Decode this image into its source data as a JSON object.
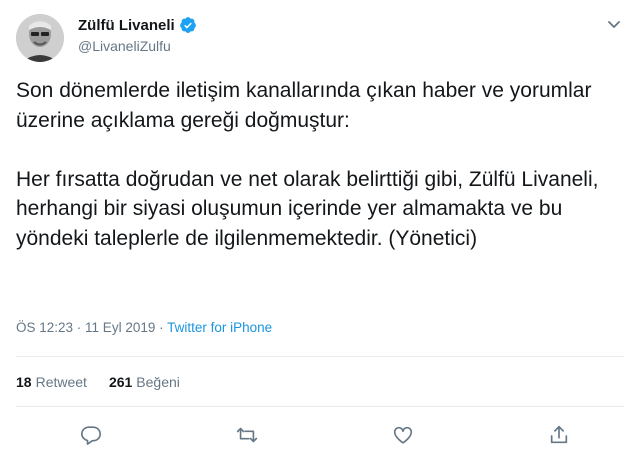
{
  "author": {
    "name": "Zülfü Livaneli",
    "handle": "@LivaneliZulfu"
  },
  "tweet": {
    "paragraph1": "Son dönemlerde iletişim kanallarında çıkan haber ve yorumlar üzerine açıklama gereği doğmuştur:",
    "paragraph2": "Her fırsatta doğrudan ve net olarak belirttiği gibi, Zülfü Livaneli, herhangi bir siyasi oluşumun içerinde yer almamakta ve  bu yöndeki taleplerle de ilgilenmemektedir. (Yönetici)"
  },
  "meta": {
    "time": "ÖS 12:23",
    "separator1": " · ",
    "date": "11 Eyl 2019",
    "separator2": " · ",
    "source": "Twitter for iPhone"
  },
  "stats": {
    "retweet_count": "18",
    "retweet_label": "Retweet",
    "like_count": "261",
    "like_label": "Beğeni"
  },
  "icons": {
    "verified": "verified-badge-icon",
    "more": "chevron-down-icon",
    "reply": "reply-icon",
    "retweet": "retweet-icon",
    "like": "like-icon",
    "share": "share-icon"
  },
  "colors": {
    "accent": "#1da1f2",
    "link": "#1b95e0",
    "secondary_text": "#657786",
    "icon_gray": "#657786"
  }
}
